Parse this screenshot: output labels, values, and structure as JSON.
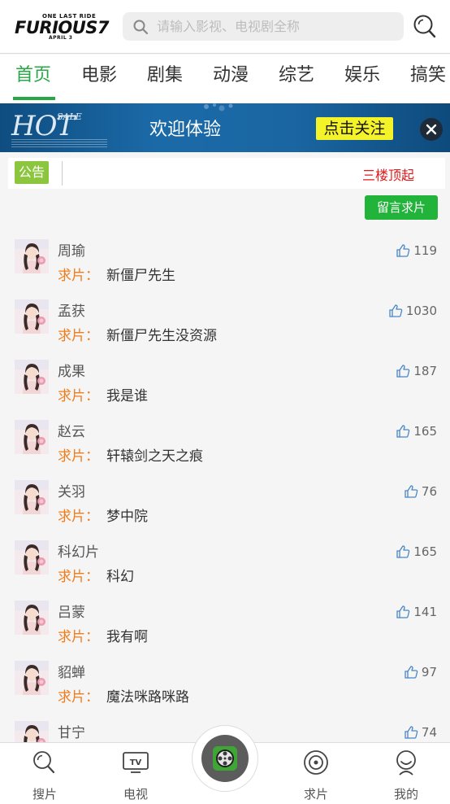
{
  "header": {
    "logo": {
      "top_text": "ONE LAST RIDE",
      "brand": "FURIOUS7",
      "bottom_text": "APRIL 3"
    },
    "search_placeholder": "请输入影视、电视剧全称"
  },
  "tabs": [
    "首页",
    "电影",
    "剧集",
    "动漫",
    "综艺",
    "娱乐",
    "搞笑"
  ],
  "active_tab": "首页",
  "banner": {
    "logo_main": "HOT",
    "logo_sub": "SALE",
    "welcome": "欢迎体验",
    "follow_label": "点击关注"
  },
  "notice": {
    "tag": "公告",
    "text": "三楼顶起"
  },
  "request_button": "留言求片",
  "request_prefix": "求片：",
  "items": [
    {
      "name": "周瑜",
      "request": "新僵尸先生",
      "likes": "119"
    },
    {
      "name": "孟获",
      "request": "新僵尸先生没资源",
      "likes": "1030"
    },
    {
      "name": "成果",
      "request": "我是谁",
      "likes": "187"
    },
    {
      "name": "赵云",
      "request": "轩辕剑之天之痕",
      "likes": "165"
    },
    {
      "name": "关羽",
      "request": "梦中院",
      "likes": "76"
    },
    {
      "name": "科幻片",
      "request": "科幻",
      "likes": "165"
    },
    {
      "name": "吕蒙",
      "request": "我有啊",
      "likes": "141"
    },
    {
      "name": "貂蝉",
      "request": "魔法咪路咪路",
      "likes": "97"
    },
    {
      "name": "甘宁",
      "request": "",
      "likes": "74"
    }
  ],
  "bottom_nav": [
    {
      "label": "搜片",
      "icon": "search-icon"
    },
    {
      "label": "电视",
      "icon": "tv-icon"
    },
    {
      "label": "求片",
      "icon": "target-icon"
    },
    {
      "label": "我的",
      "icon": "profile-icon"
    }
  ],
  "colors": {
    "accent_green": "#28a745",
    "request_orange": "#f07d1b",
    "notice_red": "#e0191b",
    "banner_blue": "#1b6aa8",
    "follow_yellow": "#f4f229"
  }
}
